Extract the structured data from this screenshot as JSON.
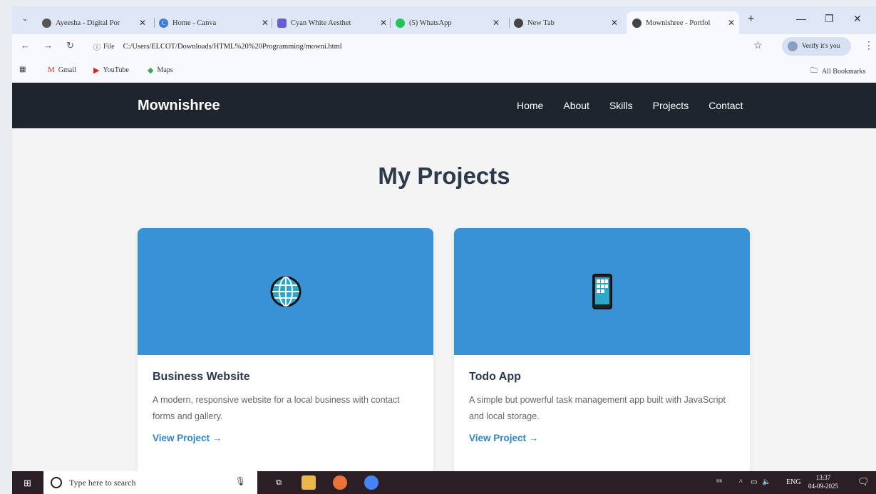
{
  "browser": {
    "tabs": [
      {
        "title": "Ayeesha - Digital Por",
        "icon": "globe-icon"
      },
      {
        "title": "Home - Canva",
        "icon": "canva-icon"
      },
      {
        "title": "Cyan White Aesthet",
        "icon": "canva-design-icon"
      },
      {
        "title": "(5) WhatsApp",
        "icon": "whatsapp-icon"
      },
      {
        "title": "New Tab",
        "icon": "chrome-icon"
      },
      {
        "title": "Mownishree - Portfol",
        "icon": "globe-icon",
        "active": true
      }
    ],
    "address": {
      "scheme_label": "File",
      "url": "C:/Users/ELCOT/Downloads/HTML%20%20Programming/mowni.html"
    },
    "profile_label": "Verify it's you",
    "bookmarks": [
      {
        "label": "Gmail",
        "icon": "gmail-icon"
      },
      {
        "label": "YouTube",
        "icon": "youtube-icon"
      },
      {
        "label": "Maps",
        "icon": "maps-icon"
      }
    ],
    "all_bookmarks": "All Bookmarks"
  },
  "site": {
    "brand": "Mownishree",
    "nav": [
      "Home",
      "About",
      "Skills",
      "Projects",
      "Contact"
    ],
    "section_title": "My Projects",
    "projects": [
      {
        "icon": "🌐",
        "icon_name": "globe-icon",
        "title": "Business Website",
        "description": "A modern, responsive website for a local business with contact forms and gallery.",
        "link": "View Project →"
      },
      {
        "icon": "📱",
        "icon_name": "mobile-phone-icon",
        "title": "Todo App",
        "description": "A simple but powerful task management app built with JavaScript and local storage.",
        "link": "View Project →"
      }
    ]
  },
  "taskbar": {
    "search_placeholder": "Type here to search",
    "language": "ENG",
    "time": "13:37",
    "date": "04-09-2025"
  },
  "colors": {
    "nav_bg": "#1f252e",
    "card_header": "#3a92d6",
    "link": "#2e86c9",
    "title": "#2c3a4e"
  }
}
